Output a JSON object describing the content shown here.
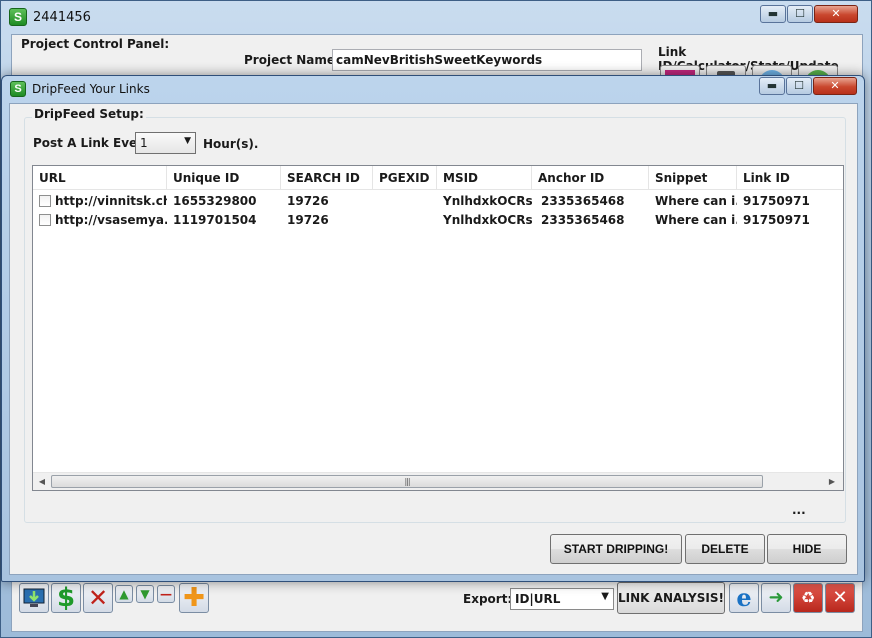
{
  "main_window": {
    "title": "2441456",
    "panel_label": "Project Control Panel:",
    "project_name_label": "Project Name:",
    "project_name_value": "camNevBritishSweetKeywords",
    "side_label": "Link ID/Calculator/Stats/Update",
    "window_buttons": {
      "minimize": "▬",
      "maximize": "☐",
      "close": "✕"
    },
    "export_label": "Export:",
    "export_value": "ID|URL",
    "link_analysis_label": "LINK ANALYSIS!"
  },
  "dialog": {
    "title": "DripFeed Your Links",
    "window_buttons": {
      "minimize": "▬",
      "maximize": "☐",
      "close": "✕"
    },
    "group_label": "DripFeed Setup:",
    "post_label": "Post A Link Every:",
    "post_value": "1",
    "hours_label": "Hour(s).",
    "columns": [
      "URL",
      "Unique ID",
      "SEARCH ID",
      "PGEXID",
      "MSID",
      "Anchor ID",
      "Snippet",
      "Link ID"
    ],
    "rows": [
      {
        "url": "http://vinnitsk.ch...",
        "unique_id": "1655329800",
        "search_id": "19726",
        "pgexid": "",
        "msid": "YnlhdxkOCRs...",
        "anchor_id": "2335365468",
        "snippet": "Where can i...",
        "link_id": "91750971"
      },
      {
        "url": "http://vsasemya.ru",
        "unique_id": "1119701504",
        "search_id": "19726",
        "pgexid": "",
        "msid": "YnlhdxkOCRs...",
        "anchor_id": "2335365468",
        "snippet": "Where can i...",
        "link_id": "91750971"
      }
    ],
    "status_ellipsis": "...",
    "buttons": {
      "start": "START DRIPPING!",
      "delete": "DELETE",
      "hide": "HIDE"
    }
  }
}
